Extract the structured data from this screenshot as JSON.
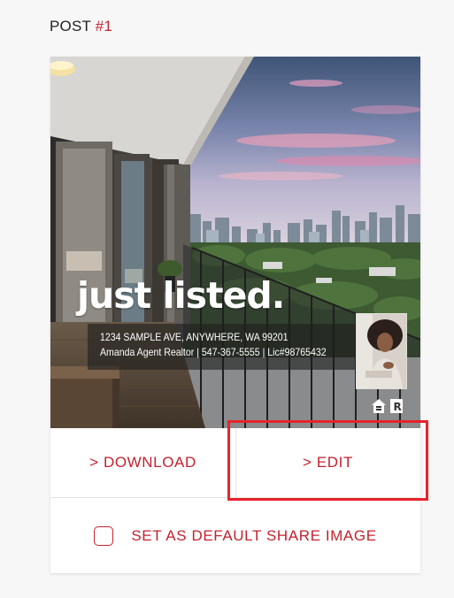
{
  "post": {
    "label": "POST",
    "number": "#1"
  },
  "listing": {
    "headline": "just listed.",
    "address": "1234 SAMPLE AVE, ANYWHERE, WA 99201",
    "agent_line": "Amanda Agent Realtor | 547-367-5555 | Lic#98765432"
  },
  "actions": {
    "download": "> DOWNLOAD",
    "edit": "> EDIT"
  },
  "default_share": {
    "label": "SET AS DEFAULT SHARE IMAGE",
    "checked": false
  },
  "colors": {
    "accent": "#c3222f",
    "highlight": "#e8232c"
  }
}
